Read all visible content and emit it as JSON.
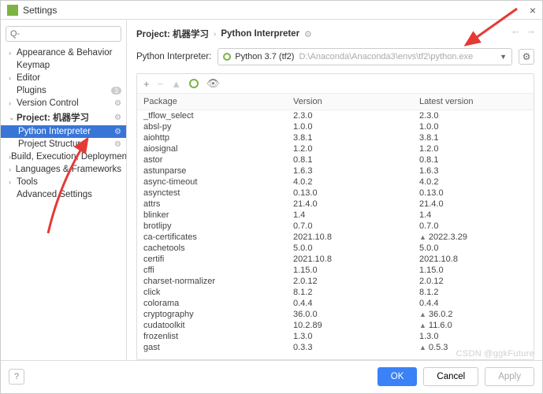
{
  "window": {
    "title": "Settings",
    "close": "×"
  },
  "search": {
    "placeholder": "Q-"
  },
  "tree": [
    {
      "label": "Appearance & Behavior",
      "chev": "›"
    },
    {
      "label": "Keymap",
      "chev": ""
    },
    {
      "label": "Editor",
      "chev": "›"
    },
    {
      "label": "Plugins",
      "chev": "",
      "badge": "3"
    },
    {
      "label": "Version Control",
      "chev": "›",
      "gear": true
    },
    {
      "label": "Project: 机器学习",
      "chev": "⌄",
      "gear": true,
      "bold": true,
      "children": [
        {
          "label": "Python Interpreter",
          "gear": true,
          "selected": true
        },
        {
          "label": "Project Structure",
          "gear": true
        }
      ]
    },
    {
      "label": "Build, Execution, Deployment",
      "chev": "›"
    },
    {
      "label": "Languages & Frameworks",
      "chev": "›"
    },
    {
      "label": "Tools",
      "chev": "›"
    },
    {
      "label": "Advanced Settings",
      "chev": ""
    }
  ],
  "breadcrumb": {
    "part1": "Project: 机器学习",
    "part2": "Python Interpreter"
  },
  "interpreter": {
    "label": "Python Interpreter:",
    "name": "Python 3.7 (tf2)",
    "path": "D:\\Anaconda\\Anaconda3\\envs\\tf2\\python.exe"
  },
  "pkg_header": {
    "package": "Package",
    "version": "Version",
    "latest": "Latest version"
  },
  "packages": [
    {
      "name": "_tflow_select",
      "version": "2.3.0",
      "latest": "2.3.0"
    },
    {
      "name": "absl-py",
      "version": "1.0.0",
      "latest": "1.0.0"
    },
    {
      "name": "aiohttp",
      "version": "3.8.1",
      "latest": "3.8.1"
    },
    {
      "name": "aiosignal",
      "version": "1.2.0",
      "latest": "1.2.0"
    },
    {
      "name": "astor",
      "version": "0.8.1",
      "latest": "0.8.1"
    },
    {
      "name": "astunparse",
      "version": "1.6.3",
      "latest": "1.6.3"
    },
    {
      "name": "async-timeout",
      "version": "4.0.2",
      "latest": "4.0.2"
    },
    {
      "name": "asynctest",
      "version": "0.13.0",
      "latest": "0.13.0"
    },
    {
      "name": "attrs",
      "version": "21.4.0",
      "latest": "21.4.0"
    },
    {
      "name": "blinker",
      "version": "1.4",
      "latest": "1.4"
    },
    {
      "name": "brotlipy",
      "version": "0.7.0",
      "latest": "0.7.0"
    },
    {
      "name": "ca-certificates",
      "version": "2021.10.8",
      "latest": "2022.3.29",
      "up": true
    },
    {
      "name": "cachetools",
      "version": "5.0.0",
      "latest": "5.0.0"
    },
    {
      "name": "certifi",
      "version": "2021.10.8",
      "latest": "2021.10.8"
    },
    {
      "name": "cffi",
      "version": "1.15.0",
      "latest": "1.15.0"
    },
    {
      "name": "charset-normalizer",
      "version": "2.0.12",
      "latest": "2.0.12"
    },
    {
      "name": "click",
      "version": "8.1.2",
      "latest": "8.1.2"
    },
    {
      "name": "colorama",
      "version": "0.4.4",
      "latest": "0.4.4"
    },
    {
      "name": "cryptography",
      "version": "36.0.0",
      "latest": "36.0.2",
      "up": true
    },
    {
      "name": "cudatoolkit",
      "version": "10.2.89",
      "latest": "11.6.0",
      "up": true
    },
    {
      "name": "frozenlist",
      "version": "1.3.0",
      "latest": "1.3.0"
    },
    {
      "name": "gast",
      "version": "0.3.3",
      "latest": "0.5.3",
      "up": true
    }
  ],
  "footer": {
    "ok": "OK",
    "cancel": "Cancel",
    "apply": "Apply",
    "help": "?"
  },
  "watermark": "CSDN @ggkFuture"
}
